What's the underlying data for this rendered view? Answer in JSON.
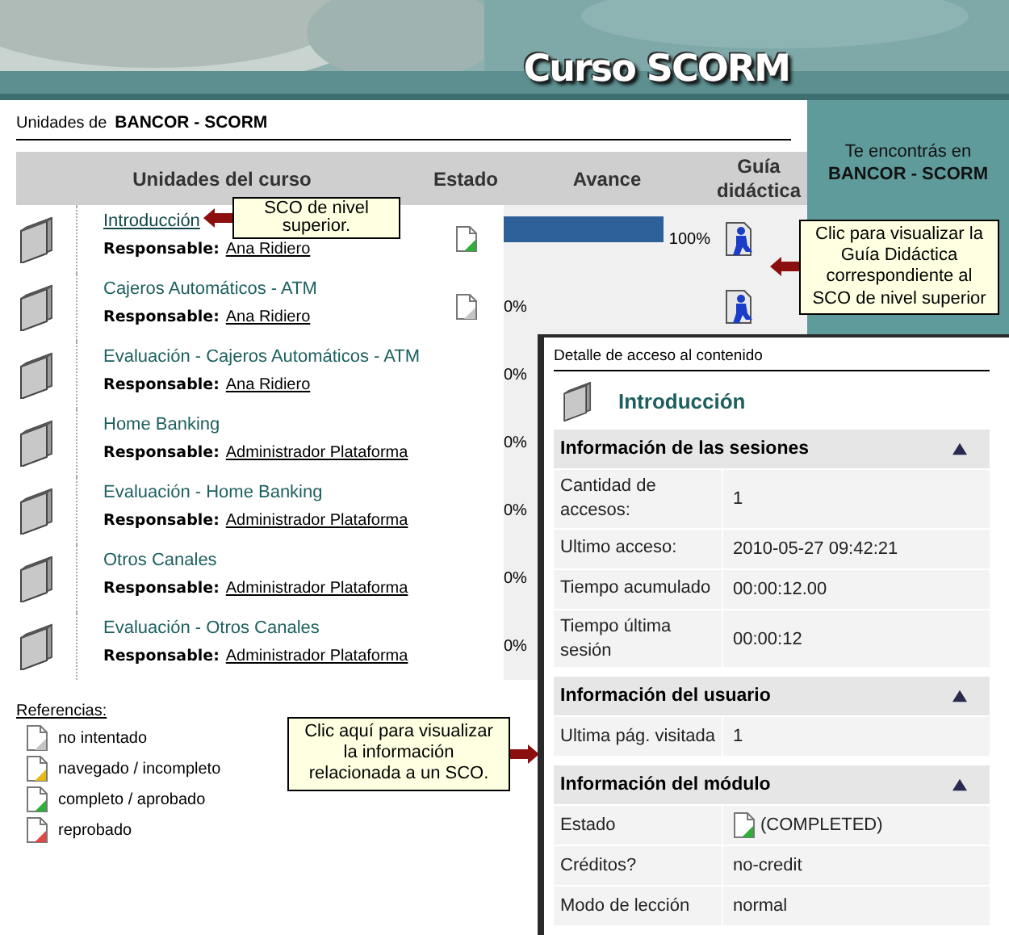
{
  "header": {
    "title": "Curso SCORM"
  },
  "breadcrumb": {
    "label": "Unidades de",
    "course": "BANCOR - SCORM"
  },
  "table": {
    "columns": [
      "Unidades del curso",
      "Estado",
      "Avance",
      "Guía didáctica"
    ],
    "rows": [
      {
        "title": "Introducción",
        "selected": true,
        "responsible_label": "Responsable:",
        "responsible": "Ana Ridiero",
        "color": "#2fae3a",
        "level": 1,
        "progress": "100%",
        "guide_icon": true
      },
      {
        "title": "Cajeros Automáticos - ATM",
        "selected": false,
        "responsible_label": "Responsable:",
        "responsible": "Ana Ridiero",
        "color": "#c4c4c4",
        "progress": "0%",
        "guide_icon": true
      },
      {
        "title": "Evaluación - Cajeros Automáticos - ATM",
        "selected": false,
        "responsible_label": "Responsable:",
        "responsible": "Ana Ridiero",
        "progress": "0%"
      },
      {
        "title": "Home Banking",
        "selected": false,
        "responsible_label": "Responsable:",
        "responsible": "Administrador Plataforma",
        "progress": "0%"
      },
      {
        "title": "Evaluación - Home Banking",
        "selected": false,
        "responsible_label": "Responsable:",
        "responsible": "Administrador Plataforma",
        "progress": "0%"
      },
      {
        "title": "Otros Canales",
        "selected": false,
        "responsible_label": "Responsable:",
        "responsible": "Administrador Plataforma",
        "progress": "0%"
      },
      {
        "title": "Evaluación - Otros Canales",
        "selected": false,
        "responsible_label": "Responsable:",
        "responsible": "Administrador Plataforma",
        "progress": "0%"
      }
    ]
  },
  "legend": {
    "title": "Referencias:",
    "items": [
      {
        "color": "#c4c4c4",
        "label": "no intentado"
      },
      {
        "color": "#e6b818",
        "label": "navegado / incompleto"
      },
      {
        "color": "#2fae3a",
        "label": "completo / aprobado"
      },
      {
        "color": "#e04848",
        "label": "reprobado"
      }
    ]
  },
  "sidebar": {
    "label": "Te encontrás en",
    "course": "BANCOR - SCORM"
  },
  "callouts": [
    {
      "text": "SCO de nivel superior.",
      "kind": "left"
    },
    {
      "text": "Clic para visualizar la Guía Didáctica correspondiente al SCO de nivel superior",
      "kind": "left"
    },
    {
      "text": "Clic aquí para visualizar la información relacionada a un SCO.",
      "kind": "right"
    }
  ],
  "detail": {
    "caption": "Detalle de acceso al contenido",
    "title": "Introducción",
    "sections": [
      {
        "title": "Información de las sesiones",
        "expanded": true,
        "rows": [
          {
            "label": "Cantidad de accesos:",
            "value": "1"
          },
          {
            "label": "Ultimo acceso:",
            "value": "2010-05-27 09:42:21"
          },
          {
            "label": "Tiempo acumulado",
            "value": "00:00:12.00"
          },
          {
            "label": "Tiempo última sesión",
            "value": "00:00:12"
          }
        ]
      },
      {
        "title": "Información del usuario",
        "expanded": true,
        "rows": [
          {
            "label": "Ultima pág. visitada",
            "value": "1"
          }
        ]
      },
      {
        "title": "Información del módulo",
        "expanded": true,
        "rows": [
          {
            "label": "Estado",
            "value": "(COMPLETED)",
            "color": "#2fae3a"
          },
          {
            "label": "Créditos?",
            "value": "no-credit"
          },
          {
            "label": "Modo de lección",
            "value": "normal"
          }
        ]
      }
    ]
  }
}
